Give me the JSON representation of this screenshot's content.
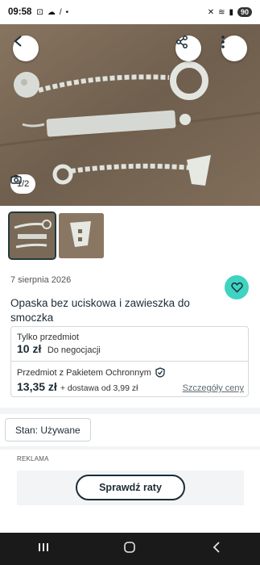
{
  "status_bar": {
    "time": "09:58",
    "battery": "90"
  },
  "gallery": {
    "counter": "1/2",
    "thumbnails": [
      "photo-1",
      "photo-2"
    ]
  },
  "listing": {
    "date": "7 sierpnia 2026",
    "title": "Opaska bez uciskowa i zawieszka do smoczka",
    "price_label": "Tylko przedmiot",
    "price": "10 zł",
    "negotiable": "Do negocjacji",
    "protection_label": "Przedmiot z Pakietem Ochronnym",
    "protected_price": "13,35 zł",
    "shipping": "+ dostawa od 3,99 zł",
    "details_link": "Szczegóły ceny",
    "condition": "Stan: Używane"
  },
  "ad": {
    "label": "REKLAMA",
    "button": "Sprawdź raty"
  },
  "colors": {
    "accent": "#3fd3c1",
    "text_dark": "#1c2b36"
  },
  "icons": [
    "back-icon",
    "share-icon",
    "more-icon",
    "camera-icon",
    "heart-icon",
    "shield-check-icon"
  ]
}
